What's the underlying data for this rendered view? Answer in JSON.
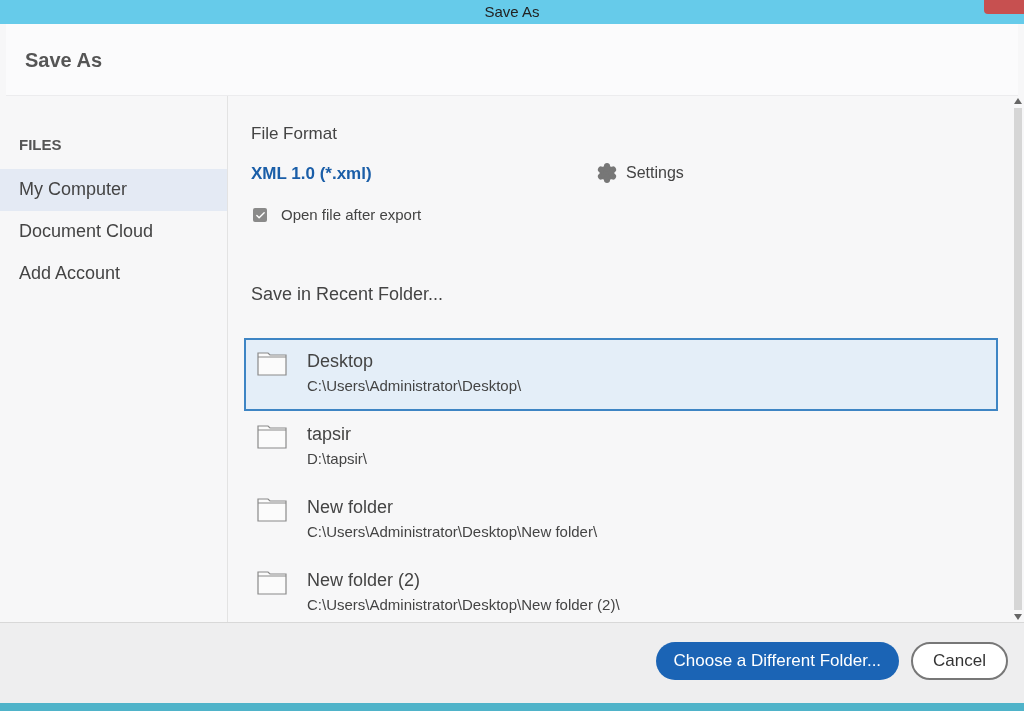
{
  "window": {
    "title": "Save As"
  },
  "dialog": {
    "title": "Save As"
  },
  "sidebar": {
    "heading": "FILES",
    "items": [
      {
        "label": "My Computer",
        "selected": true
      },
      {
        "label": "Document Cloud",
        "selected": false
      },
      {
        "label": "Add Account",
        "selected": false
      }
    ]
  },
  "format": {
    "label": "File Format",
    "value": "XML 1.0 (*.xml)",
    "settings": "Settings"
  },
  "open_after": {
    "label": "Open file after export",
    "checked": true
  },
  "recent": {
    "heading": "Save in Recent Folder...",
    "folders": [
      {
        "name": "Desktop",
        "path": "C:\\Users\\Administrator\\Desktop\\",
        "selected": true
      },
      {
        "name": "tapsir",
        "path": "D:\\tapsir\\",
        "selected": false
      },
      {
        "name": "New folder",
        "path": "C:\\Users\\Administrator\\Desktop\\New folder\\",
        "selected": false
      },
      {
        "name": "New folder (2)",
        "path": "C:\\Users\\Administrator\\Desktop\\New folder (2)\\",
        "selected": false
      }
    ]
  },
  "buttons": [
    {
      "label": "Choose a Different Folder...",
      "kind": "primary"
    },
    {
      "label": "Cancel",
      "kind": "secondary"
    }
  ]
}
